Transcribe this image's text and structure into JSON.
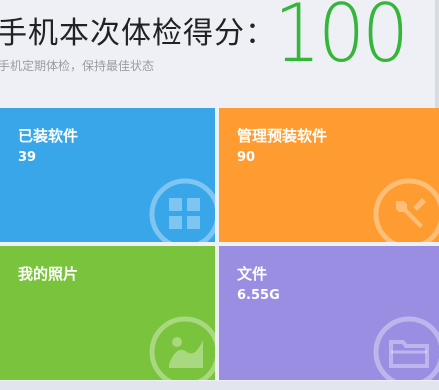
{
  "score": {
    "title": "手机本次体检得分：",
    "value": "100",
    "hint": "手机定期体检，保持最佳状态",
    "accent_color": "#35b53a"
  },
  "tiles": [
    {
      "label": "已装软件",
      "count": "39",
      "color": "#3aa6ea",
      "icon": "apps-grid-icon"
    },
    {
      "label": "管理预装软件",
      "count": "90",
      "color": "#fe9c31",
      "icon": "wrench-icon"
    },
    {
      "label": "我的照片",
      "count": "",
      "color": "#7ac33c",
      "icon": "photo-icon"
    },
    {
      "label": "文件",
      "count": "6.55G",
      "color": "#9a8ee2",
      "icon": "folder-icon"
    }
  ]
}
